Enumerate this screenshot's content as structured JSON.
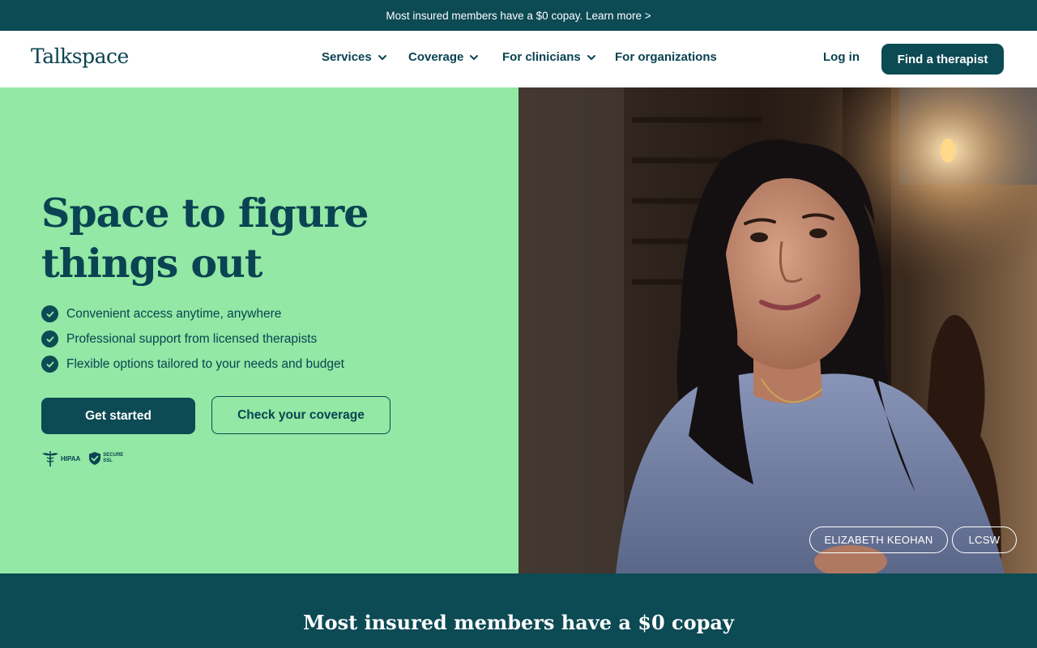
{
  "announcement": {
    "text": "Most insured members have a $0 copay. Learn more >"
  },
  "nav": {
    "logo": "Talkspace",
    "items": [
      {
        "label": "Services",
        "has_dropdown": true
      },
      {
        "label": "Coverage",
        "has_dropdown": true
      },
      {
        "label": "For clinicians",
        "has_dropdown": true
      },
      {
        "label": "For organizations",
        "has_dropdown": false
      }
    ],
    "login": "Log in",
    "cta": "Find a therapist"
  },
  "hero": {
    "headline": "Space to figure things out",
    "bullets": [
      "Convenient access anytime, anywhere",
      "Professional support from licensed therapists",
      "Flexible options tailored to your needs and budget"
    ],
    "primary_button": "Get started",
    "secondary_button": "Check your coverage",
    "badges": {
      "hipaa": "HIPAA",
      "secure": "SECURE",
      "ssl": "SSL"
    },
    "therapist": {
      "name": "ELIZABETH KEOHAN",
      "credential": "LCSW"
    }
  },
  "band": {
    "title": "Most insured members have a $0 copay",
    "subtitle": ""
  },
  "colors": {
    "brand_dark": "#0c4a54",
    "hero_green": "#92e8a4",
    "text": "#0a4352",
    "white": "#ffffff"
  },
  "icons": [
    "chevron-down-icon",
    "check-circle-icon",
    "caduceus-icon",
    "shield-check-icon"
  ]
}
